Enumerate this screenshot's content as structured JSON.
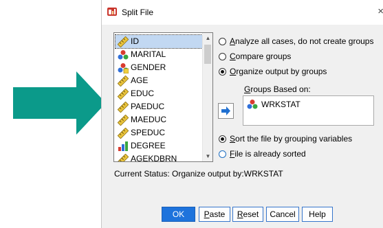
{
  "window": {
    "title": "Split File",
    "close_glyph": "×"
  },
  "variables": [
    {
      "name": "ID",
      "icon": "scale-ruler-icon",
      "selected": true
    },
    {
      "name": "MARITAL",
      "icon": "nominal-icon"
    },
    {
      "name": "GENDER",
      "icon": "nominal-icon"
    },
    {
      "name": "AGE",
      "icon": "scale-ruler-icon"
    },
    {
      "name": "EDUC",
      "icon": "scale-ruler-icon"
    },
    {
      "name": "PAEDUC",
      "icon": "scale-ruler-icon"
    },
    {
      "name": "MAEDUC",
      "icon": "scale-ruler-icon"
    },
    {
      "name": "SPEDUC",
      "icon": "scale-ruler-icon"
    },
    {
      "name": "DEGREE",
      "icon": "ordinal-icon"
    },
    {
      "name": "AGEKDBRN",
      "icon": "scale-ruler-icon"
    }
  ],
  "options": {
    "analyze_all": {
      "key": "A",
      "rest": "nalyze all cases, do not create groups",
      "checked": false
    },
    "compare": {
      "key": "C",
      "rest": "ompare groups",
      "checked": false
    },
    "organize": {
      "key": "O",
      "rest": "rganize output by groups",
      "checked": true
    }
  },
  "groups": {
    "label_key": "G",
    "label_rest": "roups Based on:",
    "items": [
      "WRKSTAT"
    ]
  },
  "sorting": {
    "sort_key": "S",
    "sort_rest": "ort the file by grouping variables",
    "sort_checked": true,
    "sorted_key": "F",
    "sorted_rest": "ile is already sorted",
    "sorted_checked": false
  },
  "status": "Current Status: Organize output by:WRKSTAT",
  "buttons": {
    "ok": "OK",
    "paste_key": "P",
    "paste_rest": "aste",
    "reset_key": "R",
    "reset_rest": "eset",
    "cancel": "Cancel",
    "help": "Help"
  },
  "colors": {
    "accent": "#1e73dc",
    "annotation_arrow": "#0b9a8a"
  }
}
